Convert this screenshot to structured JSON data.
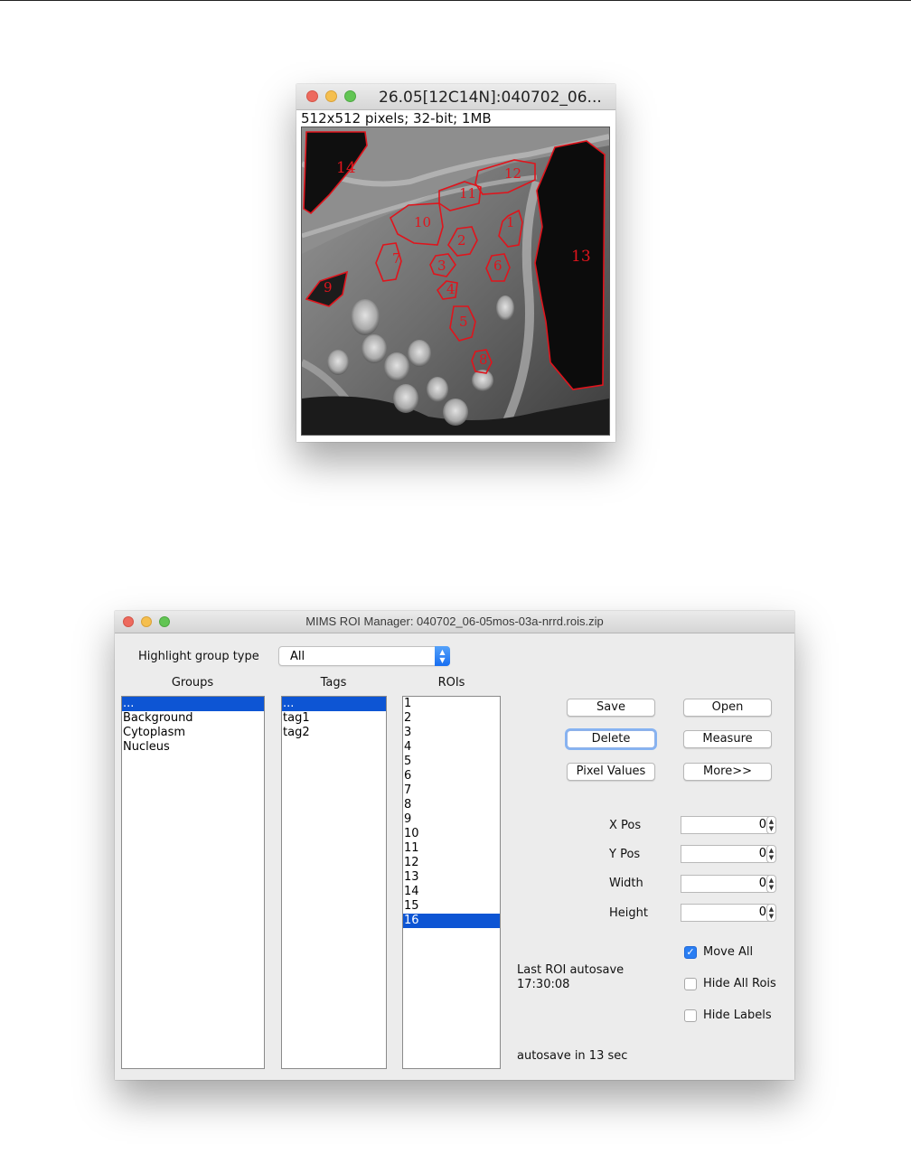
{
  "image_window": {
    "title": "26.05[12C14N]:040702_06...",
    "info": "512x512 pixels; 32-bit; 1MB",
    "roi_labels": [
      "1",
      "2",
      "3",
      "4",
      "5",
      "6",
      "7",
      "8",
      "9",
      "10",
      "11",
      "12",
      "13",
      "14"
    ],
    "roi_color": "#e0141c"
  },
  "roi_manager": {
    "title": "MIMS ROI Manager: 040702_06-05mos-03a-nrrd.rois.zip",
    "highlight_label": "Highlight group type",
    "highlight_value": "All",
    "columns": {
      "groups": "Groups",
      "tags": "Tags",
      "rois": "ROIs"
    },
    "groups": [
      "...",
      "Background",
      "Cytoplasm",
      "Nucleus"
    ],
    "tags": [
      "...",
      "tag1",
      "tag2"
    ],
    "rois": [
      "1",
      "2",
      "3",
      "4",
      "5",
      "6",
      "7",
      "8",
      "9",
      "10",
      "11",
      "12",
      "13",
      "14",
      "15",
      "16"
    ],
    "buttons": {
      "save": "Save",
      "open": "Open",
      "delete": "Delete",
      "measure": "Measure",
      "pixel_values": "Pixel Values",
      "more": "More>>"
    },
    "fields": {
      "x_pos_label": "X Pos",
      "x_pos": "0",
      "y_pos_label": "Y Pos",
      "y_pos": "0",
      "width_label": "Width",
      "width": "0",
      "height_label": "Height",
      "height": "0"
    },
    "checkboxes": {
      "move_all": "Move All",
      "move_all_checked": true,
      "hide_all_rois": "Hide All Rois",
      "hide_all_rois_checked": false,
      "hide_labels": "Hide Labels",
      "hide_labels_checked": false
    },
    "autosave_label": "Last ROI autosave",
    "autosave_time": "17:30:08",
    "autosave_countdown": "autosave in 13 sec",
    "selection_color": "#0d55d4"
  }
}
